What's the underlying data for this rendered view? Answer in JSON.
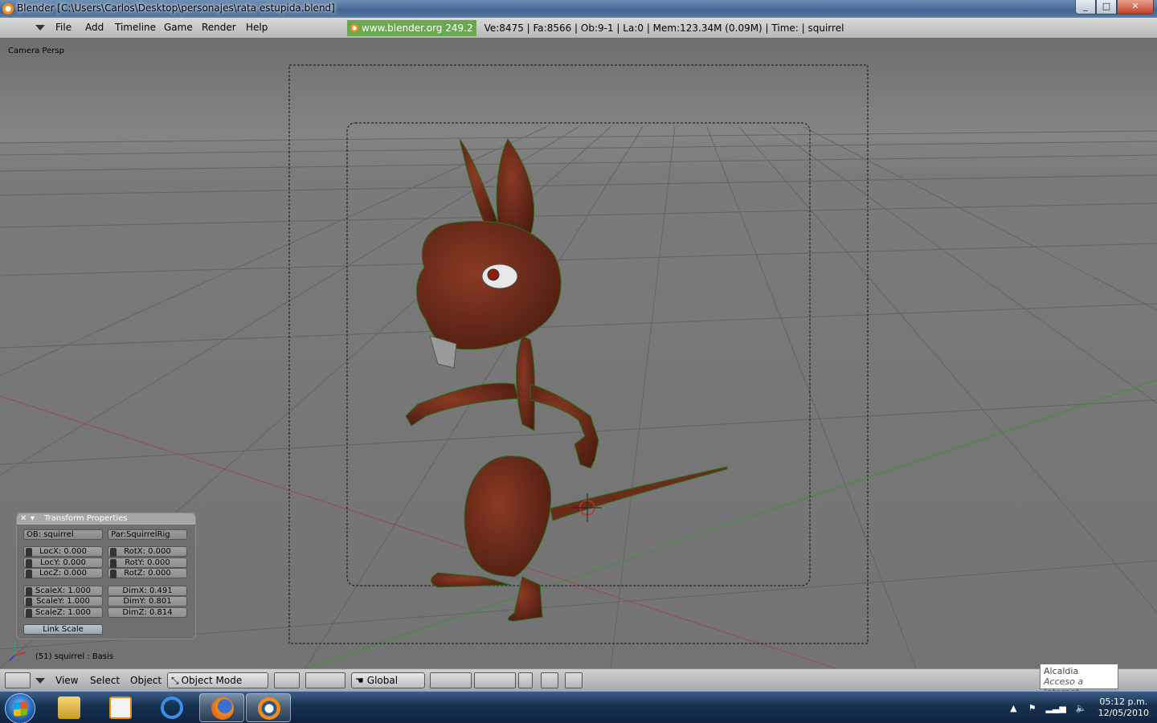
{
  "window": {
    "title": "Blender [C:\\Users\\Carlos\\Desktop\\personajes\\rata estupida.blend]",
    "buttons": [
      "_",
      "□",
      "✕"
    ]
  },
  "menubar": {
    "items": [
      "File",
      "Add",
      "Timeline",
      "Game",
      "Render",
      "Help"
    ],
    "site": "www.blender.org 249.2",
    "stats": "Ve:8475 | Fa:8566 | Ob:9-1 | La:0  | Mem:123.34M (0.09M)  | Time: | squirrel"
  },
  "viewport": {
    "label": "Camera Persp",
    "status_object": "(51) squirrel : Basis"
  },
  "transform_panel": {
    "title": "Transform Properties",
    "ob": "OB: squirrel",
    "par": "Par:SquirrelRig",
    "loc": [
      "LocX: 0.000",
      "LocY: 0.000",
      "LocZ: 0.000"
    ],
    "rot": [
      "RotX: 0.000",
      "RotY: 0.000",
      "RotZ: 0.000"
    ],
    "scale": [
      "ScaleX: 1.000",
      "ScaleY: 1.000",
      "ScaleZ: 1.000"
    ],
    "dim": [
      "DimX: 0.491",
      "DimY: 0.801",
      "DimZ: 0.814"
    ],
    "link_scale": "Link Scale"
  },
  "view_header": {
    "menus": [
      "View",
      "Select",
      "Object"
    ],
    "mode": "Object Mode",
    "orientation": "Global"
  },
  "tooltip": {
    "title": "Alcaldia",
    "subtitle": "Acceso a Internet"
  },
  "tray": {
    "time": "05:12 p.m.",
    "date": "12/05/2010"
  },
  "colors": {
    "viewport_bg": "#737373",
    "character": "#6b2b1a",
    "green_badge": "#6aa84f",
    "taskbar": "#16304f"
  }
}
